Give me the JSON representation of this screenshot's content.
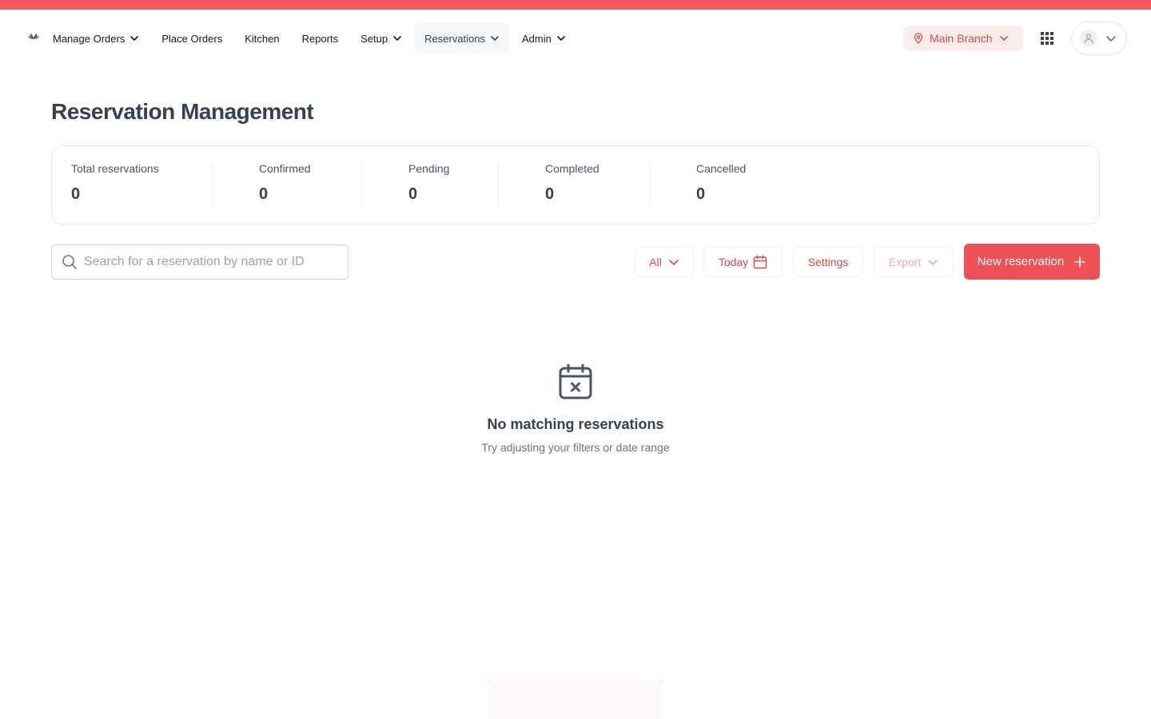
{
  "nav": {
    "items": [
      {
        "label": "Manage Orders",
        "dropdown": true,
        "active": false
      },
      {
        "label": "Place Orders",
        "dropdown": false,
        "active": false
      },
      {
        "label": "Kitchen",
        "dropdown": false,
        "active": false
      },
      {
        "label": "Reports",
        "dropdown": false,
        "active": false
      },
      {
        "label": "Setup",
        "dropdown": true,
        "active": false
      },
      {
        "label": "Reservations",
        "dropdown": true,
        "active": true
      },
      {
        "label": "Admin",
        "dropdown": true,
        "active": false
      }
    ],
    "branch": "Main Branch",
    "icons": {
      "logo": "leaf-logo",
      "branch": "map-pin-icon",
      "apps": "grid-icon",
      "user": "user-icon"
    }
  },
  "page": {
    "title": "Reservation Management"
  },
  "stats": [
    {
      "label": "Total reservations",
      "value": "0"
    },
    {
      "label": "Confirmed",
      "value": "0"
    },
    {
      "label": "Pending",
      "value": "0"
    },
    {
      "label": "Completed",
      "value": "0"
    },
    {
      "label": "Cancelled",
      "value": "0"
    }
  ],
  "toolbar": {
    "search_placeholder": "Search for a reservation by name or ID",
    "search_value": "",
    "filter_label": "All",
    "date_label": "Today",
    "settings_label": "Settings",
    "export_label": "Export",
    "new_label": "New reservation"
  },
  "empty": {
    "title": "No matching reservations",
    "subtitle": "Try adjusting your filters or date range"
  },
  "colors": {
    "brand": "#ee5257",
    "topbar": "#f05a5f",
    "brand_soft": "#fdecec",
    "text_dark": "#374151",
    "text_muted": "#6b7280"
  }
}
